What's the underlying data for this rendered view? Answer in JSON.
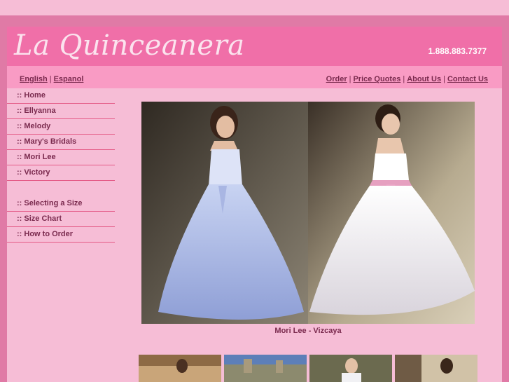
{
  "header": {
    "logo": "La Quinceanera",
    "phone": "1.888.883.7377"
  },
  "language_links": [
    "English",
    "Espanol"
  ],
  "top_links": [
    "Order",
    "Price Quotes",
    "About Us",
    "Contact Us"
  ],
  "sidebar": {
    "group1": [
      ":: Home",
      ":: Ellyanna",
      ":: Melody",
      ":: Mary's Bridals",
      ":: Mori Lee",
      ":: Victory"
    ],
    "group2": [
      ":: Selecting a Size",
      ":: Size Chart",
      ":: How to Order"
    ]
  },
  "main": {
    "caption": "Mori Lee - Vizcaya"
  },
  "colors": {
    "accent": "#f06fa8",
    "frame": "#e07aa6",
    "background": "#f6bdd6",
    "text": "#7a2a4e"
  }
}
